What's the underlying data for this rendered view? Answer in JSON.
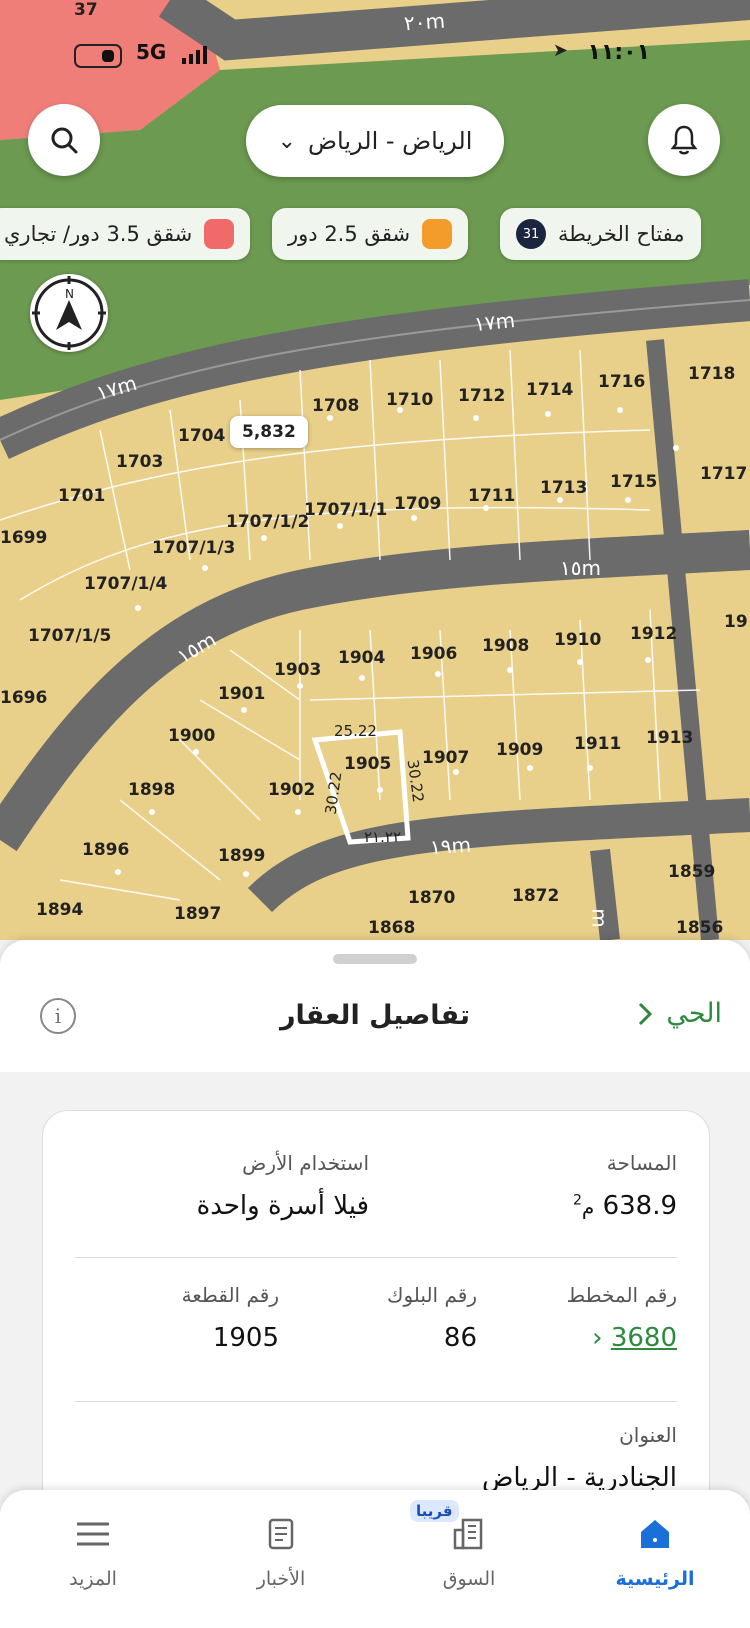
{
  "status_bar": {
    "network": "5G",
    "time": "١١:٠١"
  },
  "header": {
    "city_label": "الرياض - الرياض"
  },
  "legend": {
    "items": [
      {
        "label": "مفتاح الخريطة",
        "badge": "31"
      },
      {
        "label": "شقق 2.5 دور",
        "color": "#f39c2c"
      },
      {
        "label": "شقق 3.5 دور/ تجاري",
        "color": "#f06a6a"
      }
    ]
  },
  "map": {
    "selected_area_label": "5,832",
    "streets": [
      "٢٠m",
      "١٧m",
      "١٧m",
      "١٥m",
      "١٥m",
      "١٩m",
      "m"
    ],
    "plots": [
      "1708",
      "1710",
      "1712",
      "1714",
      "1716",
      "1718",
      "1704",
      "1703",
      "1701",
      "1707/1/1",
      "1707/1/2",
      "1709",
      "1711",
      "1713",
      "1715",
      "1717",
      "1699",
      "1707/1/3",
      "1707/1/4",
      "1707/1/5",
      "1696",
      "1903",
      "1904",
      "1906",
      "1908",
      "1910",
      "1912",
      "19",
      "1901",
      "1900",
      "1905",
      "1907",
      "1909",
      "1911",
      "1913",
      "1898",
      "1902",
      "1896",
      "1899",
      "1894",
      "1897",
      "1870",
      "1872",
      "1859",
      "1868",
      "1856",
      "37"
    ],
    "dimensions": {
      "top": "25.22",
      "left": "30.22",
      "right": "30.22",
      "bottom": "٢١.٢٢"
    }
  },
  "sheet": {
    "title": "تفاصيل العقار",
    "district_link": "الحي",
    "area_label": "المساحة",
    "area_value": "638.9",
    "area_unit": "م",
    "area_unit_sup": "2",
    "land_use_label": "استخدام الأرض",
    "land_use_value": "فيلا أسرة واحدة",
    "plan_label": "رقم المخطط",
    "plan_value": "3680",
    "block_label": "رقم البلوك",
    "block_value": "86",
    "plot_label": "رقم القطعة",
    "plot_value": "1905",
    "address_label": "العنوان",
    "address_value": "الجنادرية - الرياض"
  },
  "tabbar": {
    "soon_badge": "قريبا",
    "tabs": [
      {
        "label": "الرئيسية",
        "icon": "home-icon"
      },
      {
        "label": "السوق",
        "icon": "building-icon"
      },
      {
        "label": "الأخبار",
        "icon": "news-icon"
      },
      {
        "label": "المزيد",
        "icon": "menu-icon"
      }
    ]
  },
  "colors": {
    "accent": "#2d8a3c",
    "active_tab": "#1a6fd8",
    "plot_fill": "#e8d08a",
    "road": "#6b6b6b",
    "park": "#6a9a4e"
  }
}
